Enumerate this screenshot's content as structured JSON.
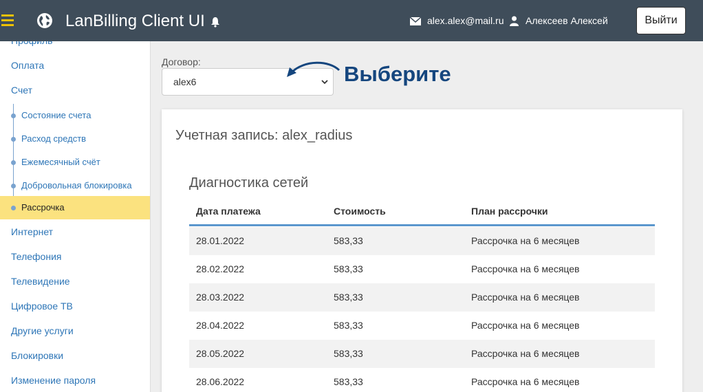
{
  "header": {
    "app_title": "LanBilling Client UI",
    "email": "alex.alex@mail.ru",
    "username": "Алексеев Алексей",
    "logout_label": "Выйти"
  },
  "sidebar": {
    "items": [
      {
        "label": "Профиль"
      },
      {
        "label": "Оплата"
      },
      {
        "label": "Счет"
      },
      {
        "label": "Интернет"
      },
      {
        "label": "Телефония"
      },
      {
        "label": "Телевидение"
      },
      {
        "label": "Цифровое ТВ"
      },
      {
        "label": "Другие услуги"
      },
      {
        "label": "Блокировки"
      },
      {
        "label": "Изменение пароля"
      }
    ],
    "subitems": [
      {
        "label": "Состояние счета"
      },
      {
        "label": "Расход средств"
      },
      {
        "label": "Ежемесячный счёт"
      },
      {
        "label": "Добровольная блокировка"
      },
      {
        "label": "Рассрочка"
      }
    ]
  },
  "contract": {
    "label": "Договор:",
    "selected": "alex6",
    "hint": "Выберите"
  },
  "main": {
    "account_title": "Учетная запись: alex_radius",
    "section_title": "Диагностика сетей",
    "columns": [
      "Дата платежа",
      "Стоимость",
      "План рассрочки"
    ],
    "rows": [
      [
        "28.01.2022",
        "583,33",
        "Рассрочка на 6 месяцев"
      ],
      [
        "28.02.2022",
        "583,33",
        "Рассрочка на 6 месяцев"
      ],
      [
        "28.03.2022",
        "583,33",
        "Рассрочка на 6 месяцев"
      ],
      [
        "28.04.2022",
        "583,33",
        "Рассрочка на 6 месяцев"
      ],
      [
        "28.05.2022",
        "583,33",
        "Рассрочка на 6 месяцев"
      ],
      [
        "28.06.2022",
        "583,33",
        "Рассрочка на 6 месяцев"
      ]
    ]
  },
  "colors": {
    "header_bg": "#3f4d5a",
    "accent_yellow": "#fbe27f",
    "link_blue": "#2e76b7",
    "hint_blue": "#15467e"
  }
}
